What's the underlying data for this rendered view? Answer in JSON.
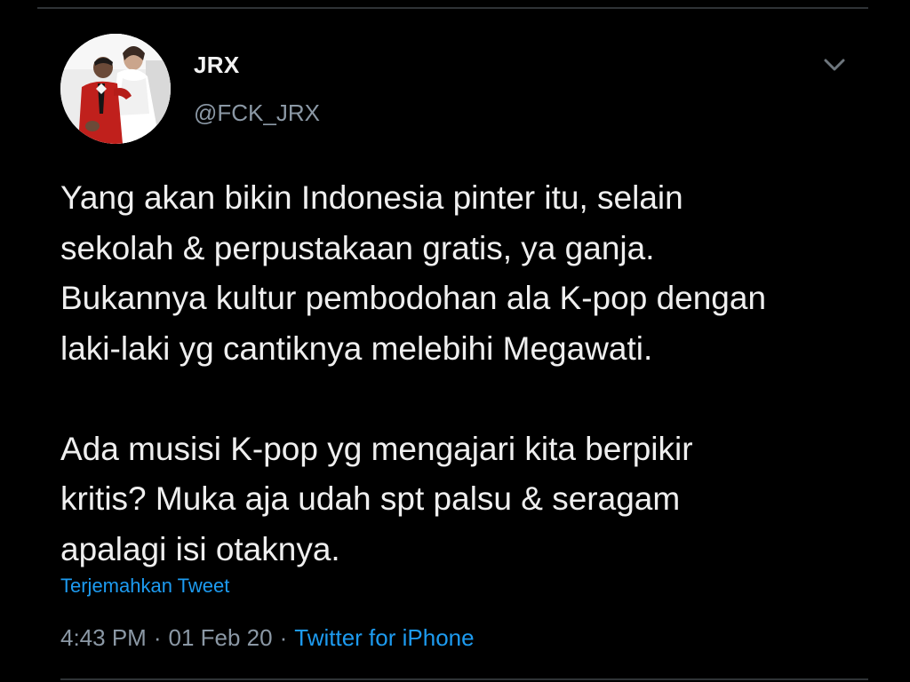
{
  "tweet": {
    "display_name": "JRX",
    "handle": "@FCK_JRX",
    "paragraph_1": "Yang akan bikin Indonesia pinter itu, selain\nsekolah & perpustakaan gratis, ya ganja.\nBukannya kultur pembodohan ala K-pop dengan\nlaki-laki yg cantiknya melebihi Megawati.",
    "paragraph_2": "Ada musisi K-pop yg mengajari kita berpikir\nkritis? Muka aja udah spt palsu & seragam\napalagi isi otaknya.",
    "translate_label": "Terjemahkan Tweet",
    "time": "4:43 PM",
    "separator": "·",
    "date": "01 Feb 20",
    "source": "Twitter for iPhone"
  },
  "icons": {
    "more": "chevron-down-icon",
    "avatar": "avatar-photo"
  },
  "colors": {
    "background": "#000000",
    "text": "#efefef",
    "secondary": "#8b98a5",
    "link": "#1d9bf0"
  }
}
